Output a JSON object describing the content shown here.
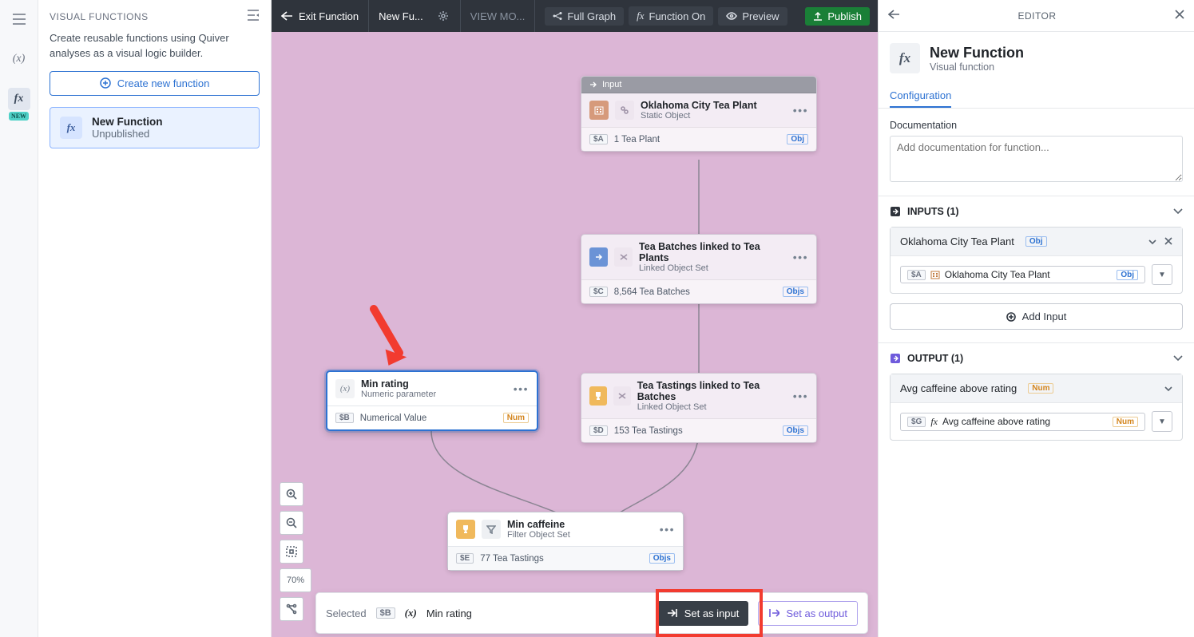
{
  "sidebar": {
    "title": "VISUAL FUNCTIONS",
    "description": "Create reusable functions using Quiver analyses as a visual logic builder.",
    "create_label": "Create new function",
    "item": {
      "name": "New Function",
      "status": "Unpublished"
    },
    "new_badge": "NEW"
  },
  "topbar": {
    "exit": "Exit Function",
    "crumb": "New Fu...",
    "viewmode": "VIEW MO...",
    "full_graph": "Full Graph",
    "function_on": "Function On",
    "preview": "Preview",
    "publish": "Publish"
  },
  "nodes": {
    "input_header": "Input",
    "a": {
      "title": "Oklahoma City Tea Plant",
      "subtitle": "Static Object",
      "ref": "$A",
      "out": "1 Tea Plant",
      "tag": "Obj"
    },
    "c": {
      "title": "Tea Batches linked to Tea Plants",
      "subtitle": "Linked Object Set",
      "ref": "$C",
      "out": "8,564 Tea Batches",
      "tag": "Objs"
    },
    "b": {
      "title": "Min rating",
      "subtitle": "Numeric parameter",
      "ref": "$B",
      "out": "Numerical Value",
      "tag": "Num"
    },
    "d": {
      "title": "Tea Tastings linked to Tea Batches",
      "subtitle": "Linked Object Set",
      "ref": "$D",
      "out": "153 Tea Tastings",
      "tag": "Objs"
    },
    "e": {
      "title": "Min caffeine",
      "subtitle": "Filter Object Set",
      "ref": "$E",
      "out": "77 Tea Tastings",
      "tag": "Objs"
    }
  },
  "zoom": "70%",
  "selection_bar": {
    "label": "Selected",
    "ref": "$B",
    "name": "Min rating",
    "set_input": "Set as input",
    "set_output": "Set as output"
  },
  "editor": {
    "title": "EDITOR",
    "name": "New Function",
    "subtitle": "Visual function",
    "tab_config": "Configuration",
    "doc_label": "Documentation",
    "doc_placeholder": "Add documentation for function...",
    "inputs_header": "INPUTS (1)",
    "input1": {
      "label": "Oklahoma City Tea Plant",
      "ref": "$A",
      "value": "Oklahoma City Tea Plant",
      "tag_head": "Obj",
      "tag_body": "Obj"
    },
    "add_input": "Add Input",
    "outputs_header": "OUTPUT (1)",
    "output1": {
      "label": "Avg caffeine above rating",
      "ref": "$G",
      "value": "Avg caffeine above rating",
      "tag_head": "Num",
      "tag_body": "Num"
    }
  }
}
